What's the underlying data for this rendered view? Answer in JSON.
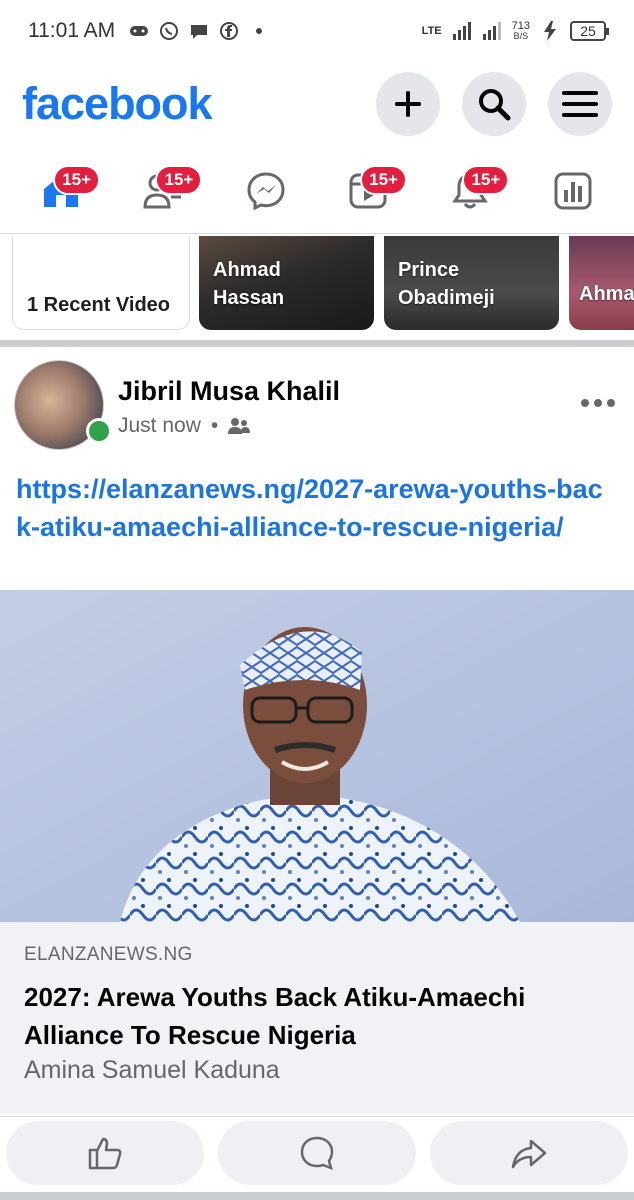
{
  "status_bar": {
    "time": "11:01 AM",
    "network": "LTE",
    "speed_value": "713",
    "speed_unit": "B/S",
    "battery": "25"
  },
  "header": {
    "logo": "facebook",
    "icons": [
      "plus-icon",
      "search-icon",
      "menu-icon"
    ]
  },
  "nav": {
    "tabs": [
      {
        "name": "home",
        "badge": "15+"
      },
      {
        "name": "friends",
        "badge": "15+"
      },
      {
        "name": "messenger",
        "badge": ""
      },
      {
        "name": "video",
        "badge": "15+"
      },
      {
        "name": "notifications",
        "badge": "15+"
      },
      {
        "name": "dashboard",
        "badge": ""
      }
    ]
  },
  "stories": {
    "recent": "1 Recent Video",
    "items": [
      {
        "line1": "Ahmad",
        "line2": "Hassan"
      },
      {
        "line1": "Prince",
        "line2": "Obadimeji"
      },
      {
        "line1": "Ahma",
        "line2": ""
      }
    ]
  },
  "post": {
    "author": "Jibril Musa Khalil",
    "time": "Just now",
    "link": "https://elanzanews.ng/2027-arewa-youths-back-atiku-amaechi-alliance-to-rescue-nigeria/",
    "preview": {
      "domain": "ELANZANEWS.NG",
      "title": "2027: Arewa Youths Back Atiku-Amaechi Alliance To Rescue Nigeria",
      "subtitle": "Amina Samuel Kaduna"
    }
  },
  "colors": {
    "brand": "#1877f2",
    "badge": "#e41e3f",
    "online": "#31a24c",
    "link": "#1b74e4"
  }
}
